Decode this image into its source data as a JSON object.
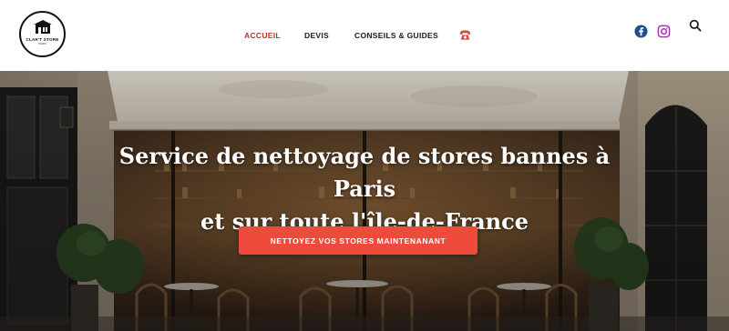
{
  "brand": {
    "name": "CLAR'T STORE",
    "city": "PARIS"
  },
  "nav": {
    "items": [
      {
        "label": "ACCUEIL",
        "active": true
      },
      {
        "label": "DEVIS",
        "active": false
      },
      {
        "label": "CONSEILS & GUIDES",
        "active": false
      }
    ],
    "phone_icon": "phone-icon"
  },
  "social": [
    "facebook-icon",
    "instagram-icon"
  ],
  "search_icon": "search-icon",
  "hero": {
    "title_line1": "Service de nettoyage de stores bannes à Paris",
    "title_line2": "et sur toute l'île-de-France",
    "cta_label": "NETTOYEZ VOS STORES MAINTENANANT"
  },
  "colors": {
    "accent": "#ef4b3c",
    "nav_active": "#b8322a",
    "facebook": "#1877f2",
    "instagram": "#a233b3"
  }
}
